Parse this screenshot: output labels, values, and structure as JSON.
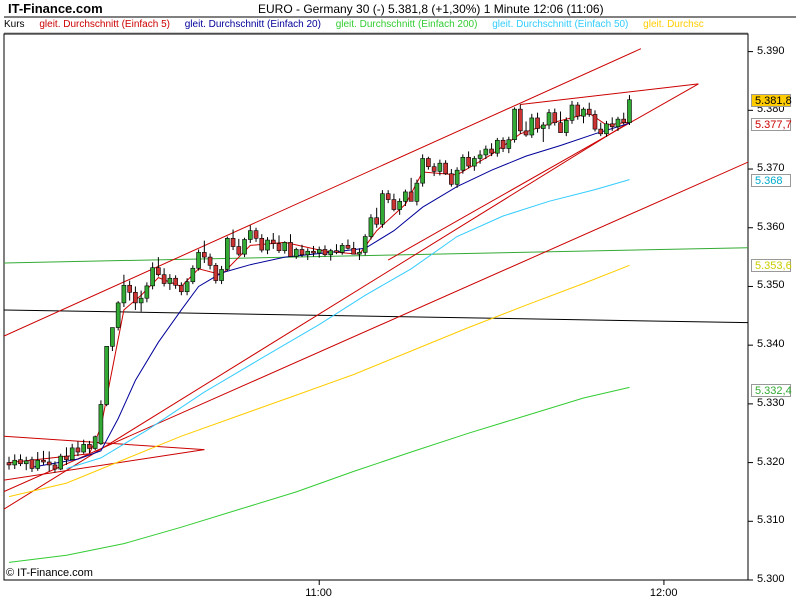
{
  "header": {
    "site": "IT-Finance.com",
    "title": "EURO - Germany 30 (-)    5.381,8 (+1,30%)    1 Minute  12:06 (11:06)"
  },
  "legend": [
    {
      "label": "Kurs",
      "color": "#000000"
    },
    {
      "label": "gleit. Durchschnitt (Einfach 5)",
      "color": "#cc0000"
    },
    {
      "label": "gleit. Durchschnitt (Einfach 20)",
      "color": "#000099"
    },
    {
      "label": "gleit. Durchschnitt (Einfach 200)",
      "color": "#33cc33"
    },
    {
      "label": "gleit. Durchschnitt (Einfach 50)",
      "color": "#33ccff"
    },
    {
      "label": "gleit. Durchsc",
      "color": "#ffcc00"
    }
  ],
  "credit": "© IT-Finance.com",
  "chart_data": {
    "type": "candlestick",
    "ylim": [
      5300,
      5393
    ],
    "y_ticks": [
      "5.390",
      "5.380",
      "5.370",
      "5.360",
      "5.350",
      "5.340",
      "5.330",
      "5.320",
      "5.310",
      "5.300"
    ],
    "x_tick_labels": [
      {
        "t": 54,
        "label": "11:00"
      },
      {
        "t": 114,
        "label": "12:00"
      }
    ],
    "candles": [
      [
        5320.0,
        5321.0,
        5318.8,
        5319.6
      ],
      [
        5319.6,
        5321.4,
        5318.9,
        5320.4
      ],
      [
        5320.5,
        5321.4,
        5319.4,
        5319.8
      ],
      [
        5319.8,
        5321.0,
        5318.7,
        5320.3
      ],
      [
        5320.5,
        5321.0,
        5318.4,
        5319.0
      ],
      [
        5319.0,
        5321.8,
        5318.6,
        5320.4
      ],
      [
        5320.4,
        5322.0,
        5319.6,
        5320.1
      ],
      [
        5320.1,
        5321.9,
        5318.5,
        5319.6
      ],
      [
        5319.6,
        5320.2,
        5318.3,
        5318.9
      ],
      [
        5318.9,
        5321.5,
        5318.7,
        5321.1
      ],
      [
        5321.1,
        5322.6,
        5319.6,
        5320.5
      ],
      [
        5320.5,
        5323.2,
        5320.4,
        5322.5
      ],
      [
        5322.5,
        5323.6,
        5321.1,
        5321.8
      ],
      [
        5321.8,
        5323.9,
        5321.5,
        5323.1
      ],
      [
        5323.1,
        5323.7,
        5321.6,
        5322.4
      ],
      [
        5322.4,
        5324.6,
        5322.1,
        5324.4
      ],
      [
        5323.2,
        5330.6,
        5323.0,
        5329.9
      ],
      [
        5329.9,
        5336.6,
        5329.6,
        5339.8
      ],
      [
        5339.8,
        5342.9,
        5339.0,
        5343.0
      ],
      [
        5343.0,
        5347.5,
        5342.5,
        5347.2
      ],
      [
        5347.2,
        5352.0,
        5346.5,
        5350.2
      ],
      [
        5350.2,
        5351.0,
        5347.6,
        5349.0
      ],
      [
        5349.0,
        5350.0,
        5346.0,
        5347.2
      ],
      [
        5347.2,
        5349.3,
        5345.7,
        5348.0
      ],
      [
        5348.0,
        5350.7,
        5347.3,
        5350.1
      ],
      [
        5350.1,
        5354.1,
        5349.5,
        5353.2
      ],
      [
        5353.2,
        5355.0,
        5351.7,
        5352.0
      ],
      [
        5352.0,
        5353.1,
        5350.0,
        5350.5
      ],
      [
        5350.5,
        5352.1,
        5349.4,
        5351.4
      ],
      [
        5351.4,
        5351.9,
        5349.6,
        5350.2
      ],
      [
        5350.2,
        5350.7,
        5348.5,
        5349.1
      ],
      [
        5349.1,
        5351.4,
        5348.5,
        5350.8
      ],
      [
        5350.8,
        5353.6,
        5350.4,
        5353.1
      ],
      [
        5353.1,
        5356.3,
        5352.7,
        5355.8
      ],
      [
        5355.8,
        5357.8,
        5354.0,
        5355.0
      ],
      [
        5355.0,
        5355.6,
        5352.9,
        5353.6
      ],
      [
        5353.6,
        5354.0,
        5350.5,
        5351.0
      ],
      [
        5351.0,
        5353.5,
        5350.4,
        5352.9
      ],
      [
        5352.9,
        5358.5,
        5352.6,
        5358.2
      ],
      [
        5358.2,
        5359.7,
        5356.2,
        5356.8
      ],
      [
        5356.8,
        5358.1,
        5355.2,
        5355.5
      ],
      [
        5355.5,
        5358.3,
        5355.0,
        5358.0
      ],
      [
        5358.0,
        5360.4,
        5357.4,
        5359.5
      ],
      [
        5359.5,
        5360.0,
        5357.6,
        5358.2
      ],
      [
        5358.2,
        5358.9,
        5355.8,
        5356.2
      ],
      [
        5356.2,
        5358.4,
        5355.5,
        5357.9
      ],
      [
        5357.9,
        5359.1,
        5356.4,
        5357.3
      ],
      [
        5357.3,
        5358.7,
        5355.7,
        5356.1
      ],
      [
        5356.1,
        5357.7,
        5355.6,
        5357.5
      ],
      [
        5357.5,
        5358.9,
        5356.8,
        5355.1
      ],
      [
        5355.1,
        5356.6,
        5354.7,
        5356.3
      ],
      [
        5356.3,
        5357.1,
        5355.0,
        5355.4
      ],
      [
        5355.4,
        5356.5,
        5354.5,
        5356.0
      ],
      [
        5356.0,
        5356.9,
        5355.1,
        5355.7
      ],
      [
        5355.7,
        5356.8,
        5354.9,
        5356.3
      ],
      [
        5356.3,
        5357.0,
        5355.1,
        5355.4
      ],
      [
        5355.4,
        5356.4,
        5354.4,
        5356.1
      ],
      [
        5356.1,
        5357.2,
        5355.5,
        5355.8
      ],
      [
        5355.8,
        5357.4,
        5355.4,
        5357.0
      ],
      [
        5357.0,
        5358.0,
        5356.3,
        5356.5
      ],
      [
        5356.5,
        5357.6,
        5355.6,
        5355.5
      ],
      [
        5355.5,
        5356.5,
        5354.5,
        5355.8
      ],
      [
        5355.8,
        5358.9,
        5355.3,
        5358.5
      ],
      [
        5358.5,
        5362.3,
        5358.0,
        5361.7
      ],
      [
        5361.7,
        5363.4,
        5360.0,
        5360.6
      ],
      [
        5360.6,
        5366.4,
        5360.0,
        5365.8
      ],
      [
        5365.8,
        5366.4,
        5364.2,
        5364.8
      ],
      [
        5364.8,
        5365.8,
        5362.8,
        5363.1
      ],
      [
        5363.1,
        5365.0,
        5362.2,
        5364.5
      ],
      [
        5364.5,
        5366.5,
        5363.7,
        5366.1
      ],
      [
        5366.1,
        5368.5,
        5365.4,
        5364.5
      ],
      [
        5364.5,
        5368.2,
        5363.8,
        5367.6
      ],
      [
        5367.6,
        5372.5,
        5367.0,
        5371.8
      ],
      [
        5371.8,
        5372.1,
        5369.9,
        5370.4
      ],
      [
        5370.4,
        5371.0,
        5368.8,
        5369.6
      ],
      [
        5369.6,
        5371.6,
        5368.9,
        5371.0
      ],
      [
        5371.0,
        5371.5,
        5369.0,
        5369.2
      ],
      [
        5369.2,
        5370.0,
        5367.0,
        5367.4
      ],
      [
        5367.4,
        5370.3,
        5366.8,
        5369.8
      ],
      [
        5369.8,
        5372.5,
        5369.2,
        5372.0
      ],
      [
        5372.0,
        5373.0,
        5370.1,
        5370.5
      ],
      [
        5370.5,
        5372.2,
        5369.7,
        5371.8
      ],
      [
        5371.8,
        5373.2,
        5370.9,
        5372.4
      ],
      [
        5372.4,
        5374.0,
        5371.7,
        5373.4
      ],
      [
        5373.4,
        5374.4,
        5372.2,
        5372.7
      ],
      [
        5372.7,
        5375.3,
        5372.1,
        5374.9
      ],
      [
        5374.9,
        5375.4,
        5372.9,
        5373.5
      ],
      [
        5373.5,
        5375.5,
        5372.7,
        5375.0
      ],
      [
        5375.0,
        5380.5,
        5374.5,
        5380.2
      ],
      [
        5380.2,
        5381.0,
        5376.0,
        5376.5
      ],
      [
        5376.5,
        5378.1,
        5375.5,
        5375.8
      ],
      [
        5375.8,
        5379.4,
        5375.3,
        5378.7
      ],
      [
        5378.7,
        5379.6,
        5376.2,
        5376.9
      ],
      [
        5376.9,
        5378.0,
        5374.6,
        5377.5
      ],
      [
        5377.5,
        5380.2,
        5376.8,
        5379.6
      ],
      [
        5379.6,
        5380.3,
        5377.4,
        5377.9
      ],
      [
        5377.9,
        5379.8,
        5376.9,
        5376.2
      ],
      [
        5376.2,
        5378.8,
        5375.6,
        5378.3
      ],
      [
        5378.3,
        5381.6,
        5377.7,
        5380.9
      ],
      [
        5380.9,
        5381.4,
        5378.4,
        5379.0
      ],
      [
        5379.0,
        5380.5,
        5377.8,
        5380.2
      ],
      [
        5380.2,
        5381.3,
        5378.9,
        5379.3
      ],
      [
        5379.3,
        5380.0,
        5376.4,
        5376.8
      ],
      [
        5376.8,
        5377.9,
        5375.6,
        5376.0
      ],
      [
        5376.0,
        5378.2,
        5375.5,
        5377.7
      ],
      [
        5377.7,
        5378.8,
        5376.5,
        5377.2
      ],
      [
        5377.2,
        5378.9,
        5376.5,
        5378.5
      ],
      [
        5378.5,
        5379.6,
        5377.6,
        5377.9
      ],
      [
        5377.9,
        5382.6,
        5377.5,
        5381.8
      ]
    ],
    "moving_averages": [
      {
        "name": "gleit. Durchschnitt (Einfach 5)",
        "color": "#cc0000",
        "points": [
          [
            0,
            5320.0
          ],
          [
            14,
            5321.5
          ],
          [
            16,
            5326.0
          ],
          [
            18,
            5336.0
          ],
          [
            20,
            5346.0
          ],
          [
            23,
            5348.5
          ],
          [
            26,
            5351.5
          ],
          [
            30,
            5350.0
          ],
          [
            33,
            5353.0
          ],
          [
            37,
            5352.0
          ],
          [
            42,
            5357.0
          ],
          [
            48,
            5357.5
          ],
          [
            55,
            5356.0
          ],
          [
            61,
            5355.5
          ],
          [
            64,
            5359.5
          ],
          [
            69,
            5364.0
          ],
          [
            72,
            5369.5
          ],
          [
            78,
            5369.0
          ],
          [
            84,
            5372.5
          ],
          [
            89,
            5376.0
          ],
          [
            95,
            5378.0
          ],
          [
            101,
            5379.5
          ],
          [
            104,
            5377.5
          ],
          [
            108,
            5378.0
          ]
        ]
      },
      {
        "name": "gleit. Durchschnitt (Einfach 20)",
        "color": "#000099",
        "points": [
          [
            4,
            5319.2
          ],
          [
            12,
            5320.6
          ],
          [
            16,
            5322.0
          ],
          [
            19,
            5327.5
          ],
          [
            22,
            5334.0
          ],
          [
            26,
            5340.5
          ],
          [
            30,
            5346.0
          ],
          [
            33,
            5350.0
          ],
          [
            37,
            5352.3
          ],
          [
            42,
            5353.7
          ],
          [
            48,
            5355.0
          ],
          [
            56,
            5355.8
          ],
          [
            62,
            5356.5
          ],
          [
            67,
            5359.5
          ],
          [
            72,
            5363.5
          ],
          [
            78,
            5367.0
          ],
          [
            84,
            5369.8
          ],
          [
            90,
            5372.2
          ],
          [
            96,
            5374.0
          ],
          [
            102,
            5376.0
          ],
          [
            108,
            5377.8
          ]
        ]
      },
      {
        "name": "gleit. Durchschnitt (Einfach 50)",
        "color": "#33ccff",
        "points": [
          [
            10,
            5319.0
          ],
          [
            16,
            5320.8
          ],
          [
            24,
            5325.5
          ],
          [
            34,
            5332.0
          ],
          [
            44,
            5337.8
          ],
          [
            54,
            5343.5
          ],
          [
            62,
            5348.5
          ],
          [
            70,
            5353.0
          ],
          [
            78,
            5358.5
          ],
          [
            86,
            5362.0
          ],
          [
            94,
            5364.5
          ],
          [
            102,
            5366.5
          ],
          [
            108,
            5368.2
          ]
        ]
      },
      {
        "name": "gleit. Durchschnitt (Einfach 200)",
        "color": "#33cc33",
        "points": [
          [
            0,
            5303.0
          ],
          [
            10,
            5304.2
          ],
          [
            20,
            5306.2
          ],
          [
            30,
            5309.0
          ],
          [
            40,
            5312.0
          ],
          [
            50,
            5315.0
          ],
          [
            60,
            5318.5
          ],
          [
            70,
            5321.8
          ],
          [
            80,
            5325.0
          ],
          [
            90,
            5328.0
          ],
          [
            100,
            5331.0
          ],
          [
            108,
            5332.8
          ]
        ]
      },
      {
        "name": "gleit. Durchsc",
        "color": "#ffcc00",
        "points": [
          [
            0,
            5314.2
          ],
          [
            10,
            5316.5
          ],
          [
            20,
            5320.5
          ],
          [
            30,
            5324.5
          ],
          [
            40,
            5328.0
          ],
          [
            50,
            5331.5
          ],
          [
            60,
            5335.0
          ],
          [
            70,
            5339.0
          ],
          [
            80,
            5343.0
          ],
          [
            90,
            5346.8
          ],
          [
            100,
            5350.5
          ],
          [
            108,
            5353.6
          ]
        ]
      }
    ],
    "horizontal_lines": [
      {
        "color": "#33aa33",
        "points": [
          [
            -1,
            5354.0
          ],
          [
            149,
            5357.0
          ]
        ]
      },
      {
        "color": "#000000",
        "points": [
          [
            -1,
            5346.0
          ],
          [
            149,
            5343.5
          ]
        ]
      }
    ],
    "trend_lines": [
      {
        "color": "#cc0000",
        "points": [
          [
            -1,
            5341.5
          ],
          [
            110,
            5390.5
          ]
        ]
      },
      {
        "color": "#cc0000",
        "points": [
          [
            -1,
            5315.0
          ],
          [
            149,
            5380.0
          ]
        ]
      },
      {
        "color": "#cc0000",
        "points": [
          [
            -1,
            5312.0
          ],
          [
            108,
            5378.0
          ]
        ]
      },
      {
        "color": "#cc0000",
        "points": [
          [
            -1,
            5324.5
          ],
          [
            34,
            5322.2
          ]
        ]
      },
      {
        "color": "#cc0000",
        "points": [
          [
            -1,
            5317.0
          ],
          [
            34,
            5322.2
          ]
        ]
      },
      {
        "color": "#cc0000",
        "points": [
          [
            89,
            5381.0
          ],
          [
            120,
            5384.5
          ]
        ]
      },
      {
        "color": "#cc0000",
        "points": [
          [
            66,
            5354.5
          ],
          [
            120,
            5384.5
          ]
        ]
      }
    ],
    "price_tags": [
      {
        "label": "5.381,8",
        "value": 5381.8,
        "bg": "#ffcc00",
        "fg": "#000000"
      },
      {
        "label": "5.377,7",
        "value": 5377.7,
        "bg": "#ffffff",
        "fg": "#cc0000"
      },
      {
        "label": "5.368",
        "value": 5368.2,
        "bg": "#ffffff",
        "fg": "#00aacc"
      },
      {
        "label": "5.353,6",
        "value": 5353.6,
        "bg": "#ffffff",
        "fg": "#cccc00"
      },
      {
        "label": "5.332,4",
        "value": 5332.4,
        "bg": "#ffffff",
        "fg": "#33aa33"
      }
    ]
  }
}
